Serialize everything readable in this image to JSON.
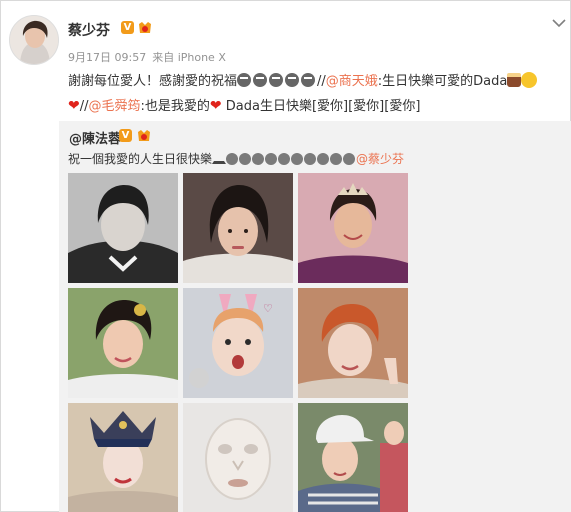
{
  "post": {
    "author": "蔡少芬",
    "date": "9月17日 09:57",
    "source": "来自 iPhone X",
    "text": {
      "part1": "謝謝每位愛人！感謝愛的祝福",
      "sep1": "//",
      "mention1": "@商天娥",
      "part2": ":生日快樂可愛的Dada",
      "sep2": "//",
      "mention2": "@毛舜筠",
      "part3": ":也是我愛的",
      "part4": " Dada生日快樂[愛你][愛你][愛你]"
    }
  },
  "repost": {
    "author": "@陳法蓉",
    "text": "祝一個我愛的人生日很快樂",
    "mention": "@蔡少芬"
  },
  "badges": {
    "verified": "V"
  },
  "colors": {
    "link": "#eb7350",
    "badge": "#f29b1a",
    "repost_bg": "#f2f2f2",
    "meta": "#939393"
  },
  "icons": [
    "chevron-down-icon",
    "verified-badge-icon",
    "vip-badge-icon",
    "emoji-icon",
    "heart-icon",
    "cake-icon",
    "smiley-icon"
  ],
  "photos": [
    "photo-child-bw",
    "photo-bob-hair",
    "photo-tiara-qipao",
    "photo-period-drama",
    "photo-bunny-filter",
    "photo-short-orange-hair",
    "photo-opera-headdress",
    "photo-face-mask",
    "photo-cap-striped"
  ]
}
